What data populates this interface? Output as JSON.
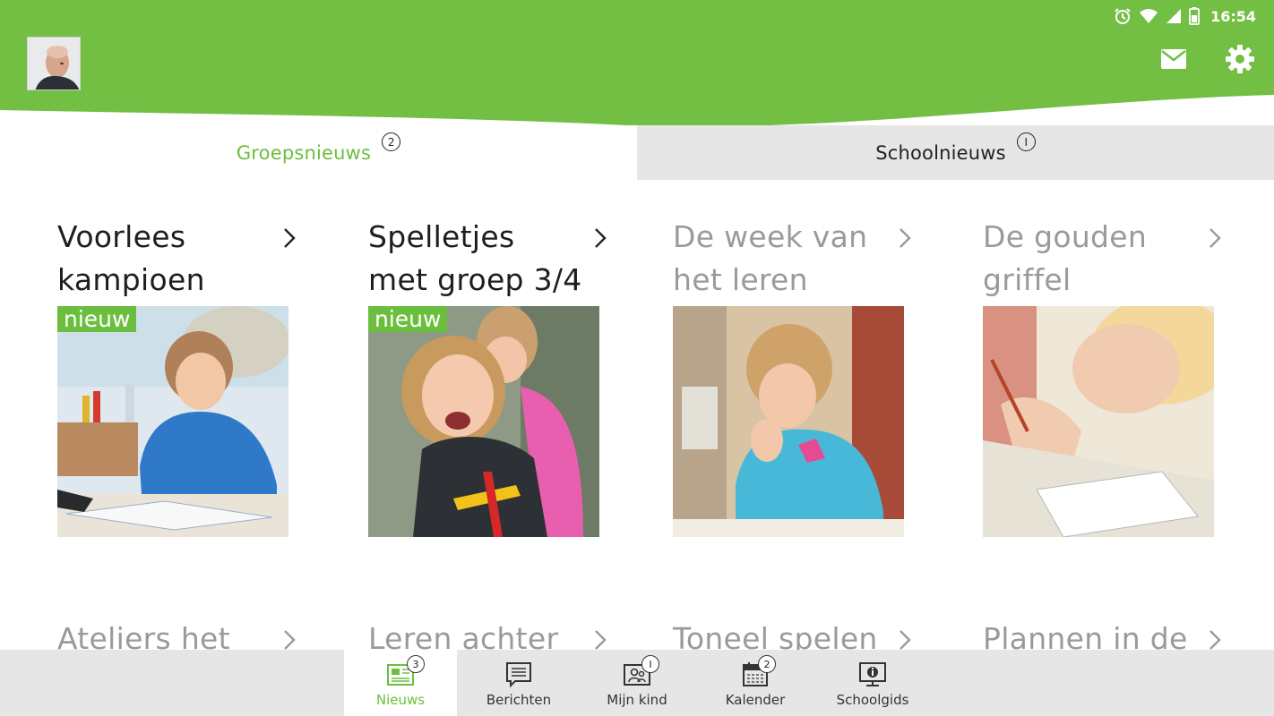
{
  "status_bar": {
    "time": "16:54",
    "icons": [
      "alarm-icon",
      "wifi-icon",
      "signal-icon",
      "battery-icon"
    ]
  },
  "header": {
    "avatar": "avatar",
    "actions": [
      "mail-icon",
      "gear-icon"
    ],
    "brand_color": "#6cbf3e"
  },
  "tabs": [
    {
      "label": "Groepsnieuws",
      "count": "2",
      "active": true
    },
    {
      "label": "Schoolnieuws",
      "count": "I",
      "active": false
    }
  ],
  "news": [
    {
      "title": "Voorlees kampioen",
      "badge": "nieuw",
      "is_new": true
    },
    {
      "title": "Spelletjes met groep 3/4",
      "badge": "nieuw",
      "is_new": true
    },
    {
      "title": "De week van het leren",
      "is_new": false
    },
    {
      "title": "De gouden griffel",
      "is_new": false
    },
    {
      "title": "Ateliers het",
      "is_new": false
    },
    {
      "title": "Leren achter",
      "is_new": false
    },
    {
      "title": "Toneel spelen",
      "is_new": false
    },
    {
      "title": "Plannen in de",
      "is_new": false
    }
  ],
  "bottom_nav": [
    {
      "label": "Nieuws",
      "badge": "3",
      "icon": "news-icon",
      "active": true
    },
    {
      "label": "Berichten",
      "badge": "",
      "icon": "messages-icon",
      "active": false
    },
    {
      "label": "Mijn kind",
      "badge": "I",
      "icon": "child-icon",
      "active": false
    },
    {
      "label": "Kalender",
      "badge": "2",
      "icon": "calendar-icon",
      "active": false
    },
    {
      "label": "Schoolgids",
      "badge": "",
      "icon": "school-guide-icon",
      "active": false
    }
  ]
}
